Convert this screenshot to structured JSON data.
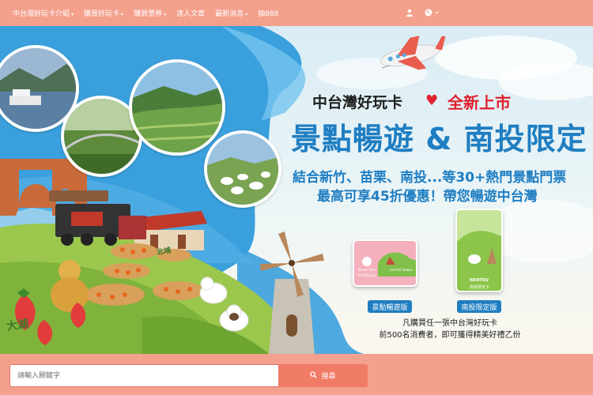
{
  "nav": {
    "items": [
      {
        "label": "中台灣好玩卡介紹",
        "dropdown": true
      },
      {
        "label": "購買好玩卡",
        "dropdown": true
      },
      {
        "label": "購買票券",
        "dropdown": true
      },
      {
        "label": "達人文章",
        "dropdown": false
      },
      {
        "label": "最新消息",
        "dropdown": true
      },
      {
        "label": "抽888",
        "dropdown": false
      }
    ],
    "caret": "▾",
    "user_icon": "user-icon",
    "globe_icon": "globe-icon"
  },
  "banner": {
    "title_small": "中台灣好玩卡",
    "heart": "♥",
    "title_new": "全新上市",
    "title_big": "景點暢遊 & 南投限定",
    "subtitle_1": "結合新竹、苗栗、南投...等30+熱門景點門票",
    "subtitle_2": "最高可享45折優惠！帶您暢遊中台灣",
    "card_left_label": "景點暢遊版",
    "card_right_label": "南投限定版",
    "card_left_text_1": "Taiwan Pass",
    "card_left_text_2": "中台灣好玩卡",
    "card_left_text_3": "Central Taiwan",
    "card_right_text_1": "NANTOU",
    "card_right_text_2": "南投限定卡",
    "promo_1": "凡購買任一張中台灣好玩卡",
    "promo_2": "前500名消費者，即可獲得精美好禮乙份",
    "map_label_1": "大湖",
    "map_label_2": "北埔"
  },
  "search": {
    "placeholder": "請輸入關鍵字",
    "button_label": "搜尋",
    "button_icon": "search-icon"
  },
  "colors": {
    "nav_bg": "#f3a08d",
    "accent_blue": "#1f7ec2",
    "accent_red": "#e0202e",
    "search_button": "#f07b67"
  }
}
